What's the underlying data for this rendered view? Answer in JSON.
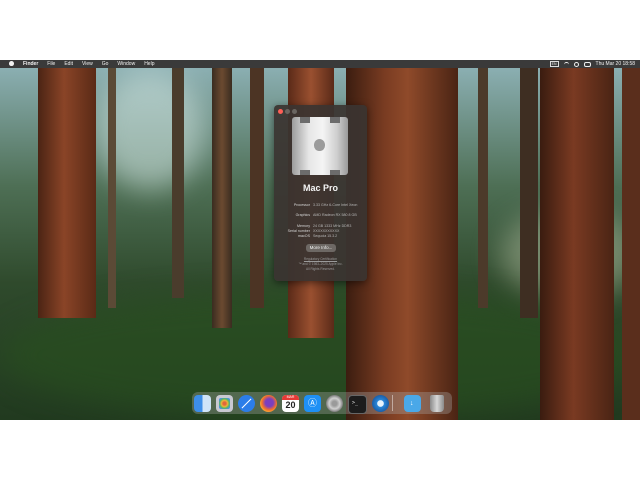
{
  "menubar": {
    "app_name": "Finder",
    "menus": [
      "File",
      "Edit",
      "View",
      "Go",
      "Window",
      "Help"
    ],
    "input_source": "EN",
    "clock": "Thu Mar 20  18:58"
  },
  "about_window": {
    "model_name": "Mac Pro",
    "specs": [
      {
        "label": "Processor",
        "value": "3.33 GHz 6-Core Intel Xeon"
      },
      {
        "label": "Graphics",
        "value": "AMD Radeon RX 580 8 GB"
      },
      {
        "label": "Memory",
        "value": "24 GB 1333 MHz DDR3"
      },
      {
        "label": "Serial number",
        "value": "XXXXXXXXXXX"
      },
      {
        "label": "macOS",
        "value": "Sequoia 15.3.2"
      }
    ],
    "more_info_label": "More Info...",
    "legal_lines": [
      "Regulatory Certification",
      "™ and © 1983–2025 Apple Inc.",
      "All Rights Reserved."
    ]
  },
  "dock": {
    "items": [
      "finder-icon",
      "launchpad-icon",
      "safari-icon",
      "firefox-icon",
      "calendar-icon",
      "app-store-icon",
      "system-settings-icon",
      "terminal-icon",
      "other-app-icon",
      "downloads-folder-icon",
      "trash-icon"
    ],
    "calendar_month": "MAR",
    "calendar_day": "20"
  }
}
